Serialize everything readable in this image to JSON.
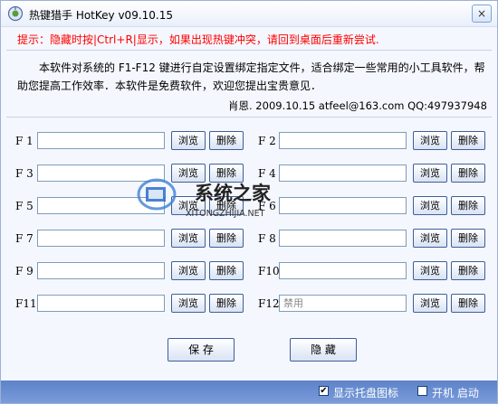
{
  "window": {
    "title": "热键猎手  HotKey v09.10.15",
    "close_glyph": "×"
  },
  "hint_text": "提示：隐藏时按|Ctrl+R|显示，如果出现热键冲突，请回到桌面后重新尝试.",
  "description": "本软件对系统的 F1-F12 键进行自定设置绑定指定文件，适合绑定一些常用的小工具软件，帮助您提高工作效率．本软件是免费软件，欢迎您提出宝贵意见．",
  "contact": "肖恩. 2009.10.15   atfeel@163.com  QQ:497937948",
  "browse_label": "浏览",
  "delete_label": "删除",
  "keys": [
    {
      "label": "F 1",
      "value": ""
    },
    {
      "label": "F 2",
      "value": ""
    },
    {
      "label": "F 3",
      "value": ""
    },
    {
      "label": "F 4",
      "value": ""
    },
    {
      "label": "F 5",
      "value": ""
    },
    {
      "label": "F 6",
      "value": ""
    },
    {
      "label": "F 7",
      "value": ""
    },
    {
      "label": "F 8",
      "value": ""
    },
    {
      "label": "F 9",
      "value": ""
    },
    {
      "label": "F10",
      "value": ""
    },
    {
      "label": "F11",
      "value": ""
    },
    {
      "label": "F12",
      "value": "禁用"
    }
  ],
  "save_label": "保 存",
  "hide_label": "隐 藏",
  "footer": {
    "tray_icon_label": "显示托盘图标",
    "tray_icon_checked": true,
    "autostart_label": "开机 启动",
    "autostart_checked": false,
    "check_glyph": "✔"
  },
  "watermark": {
    "brand": "系统之家",
    "url": "XITONGZHIJIA.NET"
  },
  "colors": {
    "hint": "#FF0000",
    "footer": "#6A8ED2",
    "button_border": "#3F5E9A"
  }
}
